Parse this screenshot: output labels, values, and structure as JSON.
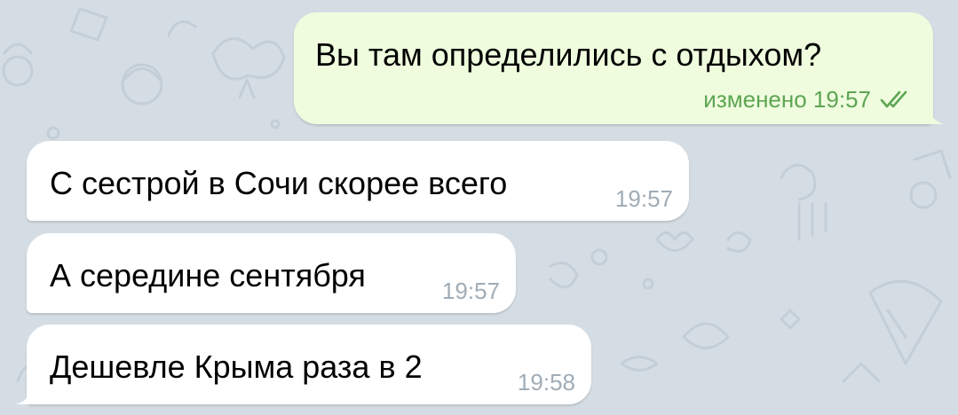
{
  "messages": [
    {
      "direction": "outgoing",
      "text": "Вы там определились с отдыхом?",
      "meta": "изменено 19:57",
      "status_icon": "double-check-icon"
    },
    {
      "direction": "incoming",
      "text": "С сестрой в Сочи скорее всего",
      "meta": "19:57"
    },
    {
      "direction": "incoming",
      "text": "А середине сентября",
      "meta": "19:57"
    },
    {
      "direction": "incoming",
      "text": "Дешевле Крыма раза в 2",
      "meta": "19:58"
    }
  ],
  "colors": {
    "background": "#d5dde4",
    "outgoing_bubble": "#effdde",
    "incoming_bubble": "#ffffff",
    "outgoing_meta": "#5ea553",
    "incoming_meta": "#a0acb6"
  }
}
